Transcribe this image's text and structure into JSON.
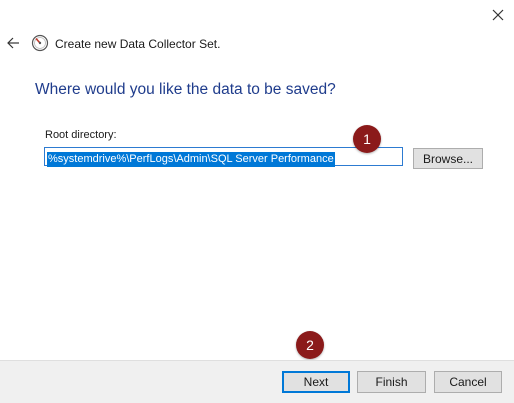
{
  "window": {
    "title": "Create new Data Collector Set.",
    "close_icon": "close-icon",
    "back_icon": "back-arrow-icon",
    "app_icon": "performance-gauge-icon"
  },
  "main": {
    "heading": "Where would you like the data to be saved?",
    "root_directory": {
      "label": "Root directory:",
      "value": "%systemdrive%\\PerfLogs\\Admin\\SQL Server Performance"
    },
    "browse_label": "Browse..."
  },
  "annotations": {
    "step1": "1",
    "step2": "2",
    "badge_color": "#8b1a1a"
  },
  "footer": {
    "next_label": "Next",
    "finish_label": "Finish",
    "cancel_label": "Cancel"
  },
  "colors": {
    "heading": "#1f3c8c",
    "selection": "#0078d7",
    "footer_bg": "#f0f0f0"
  }
}
